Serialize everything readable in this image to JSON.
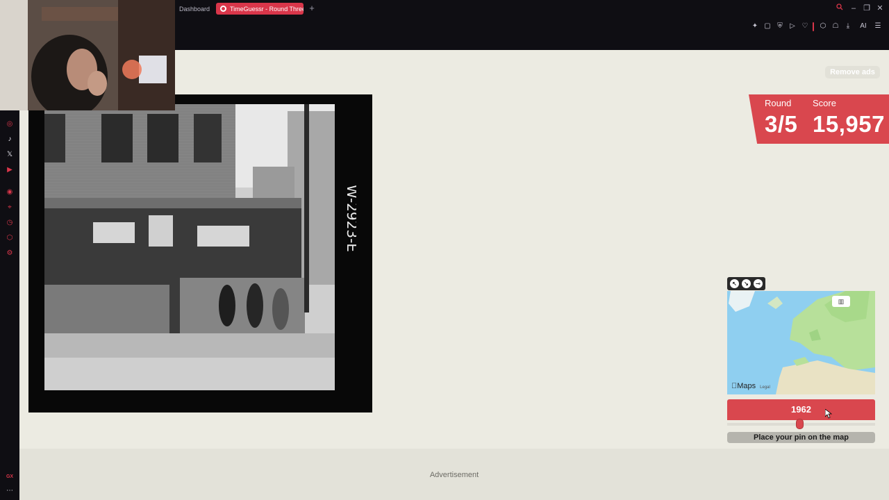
{
  "browser": {
    "tabs": [
      {
        "label": "Dashboard",
        "active": false
      },
      {
        "label": "TimeGuessr - Round Three",
        "active": true
      }
    ],
    "new_tab": "+",
    "sidebar_icons": [
      "instagram-icon",
      "tiktok-icon",
      "x-icon",
      "youtube-icon",
      "player-icon",
      "pin-icon",
      "clock-icon",
      "extensions-icon",
      "settings-icon"
    ],
    "sidebar_footer": "GX",
    "toolbar_ai": "AI"
  },
  "game": {
    "remove_ads": "Remove ads",
    "round_label": "Round",
    "round_value": "3/5",
    "score_label": "Score",
    "score_value": "15,957",
    "year": "1962",
    "year_slider_fraction": 0.49,
    "place_pin": "Place your pin on the map",
    "map_attribution": "Maps",
    "map_legal": "Legal",
    "advertisement": "Advertisement",
    "accent_color": "#d9474e"
  }
}
